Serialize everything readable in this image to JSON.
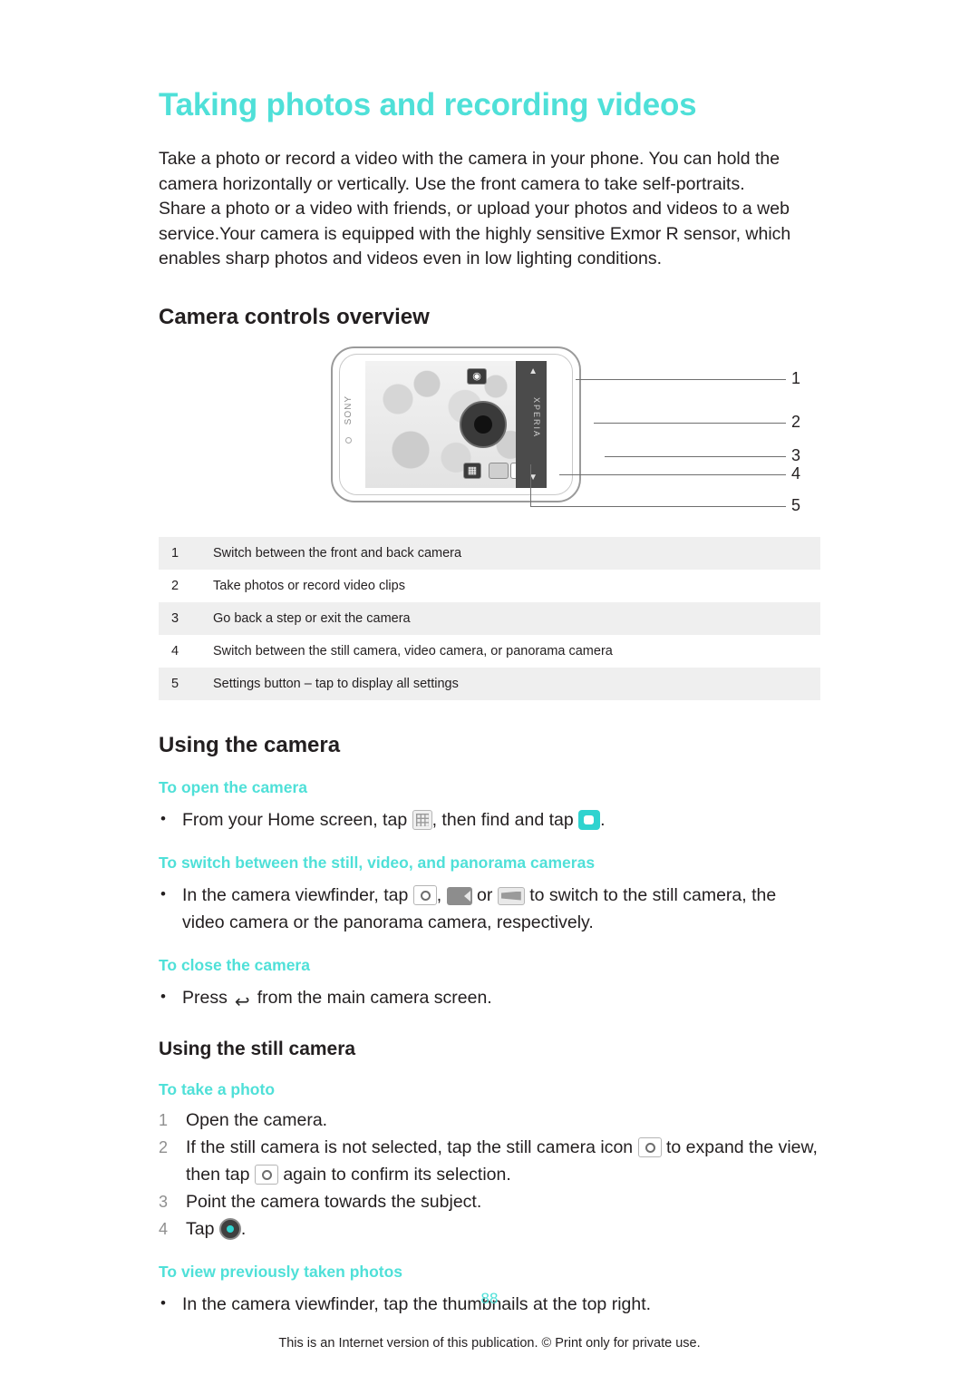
{
  "title": "Taking photos and recording videos",
  "intro": "Take a photo or record a video with the camera in your phone. You can hold the camera horizontally or vertically. Use the front camera to take self-portraits. Share a photo or a video with friends, or upload your photos and videos to a web service.Your camera is equipped with the highly sensitive Exmor R sensor, which enables sharp photos and videos even in low lighting conditions.",
  "sections": {
    "camera_controls_overview": "Camera controls overview",
    "using_the_camera": "Using the camera",
    "using_the_still_camera": "Using the still camera"
  },
  "figure": {
    "device_brand": "SONY",
    "viewfinder_side_label": "XPERIA",
    "callout_numbers": [
      "1",
      "2",
      "3",
      "4",
      "5"
    ]
  },
  "legend": {
    "rows": [
      {
        "num": "1",
        "text": "Switch between the front and back camera"
      },
      {
        "num": "2",
        "text": "Take photos or record video clips"
      },
      {
        "num": "3",
        "text": "Go back a step or exit the camera"
      },
      {
        "num": "4",
        "text": "Switch between the still camera, video camera, or panorama camera"
      },
      {
        "num": "5",
        "text": "Settings button – tap to display all settings"
      }
    ]
  },
  "procedures": {
    "open_camera": {
      "heading": "To open the camera",
      "text_before_grid": "From your Home screen, tap",
      "text_between": ", then find and tap",
      "text_end": "."
    },
    "switch_cameras": {
      "heading": "To switch between the still, video, and panorama cameras",
      "text_1": "In the camera viewfinder, tap",
      "text_2": ",",
      "text_3": "or",
      "text_4": "to switch to the still camera, the video camera or the panorama camera, respectively."
    },
    "close_camera": {
      "heading": "To close the camera",
      "text_before": "Press",
      "text_after": "from the main camera screen."
    },
    "take_photo": {
      "heading": "To take a photo",
      "steps": [
        {
          "text": "Open the camera."
        },
        {
          "text_1": "If the still camera is not selected, tap the still camera icon",
          "text_2": "to expand the view, then tap",
          "text_3": "again to confirm its selection."
        },
        {
          "text": "Point the camera towards the subject."
        },
        {
          "text_1": "Tap",
          "text_2": "."
        }
      ]
    },
    "view_photos": {
      "heading": "To view previously taken photos",
      "text": "In the camera viewfinder, tap the thumbnails at the top right."
    }
  },
  "footer": {
    "page_number": "88",
    "note": "This is an Internet version of this publication. © Print only for private use."
  },
  "colors": {
    "teal": "#4fe0d8",
    "text": "#231f20",
    "table_alt": "#efefef"
  }
}
